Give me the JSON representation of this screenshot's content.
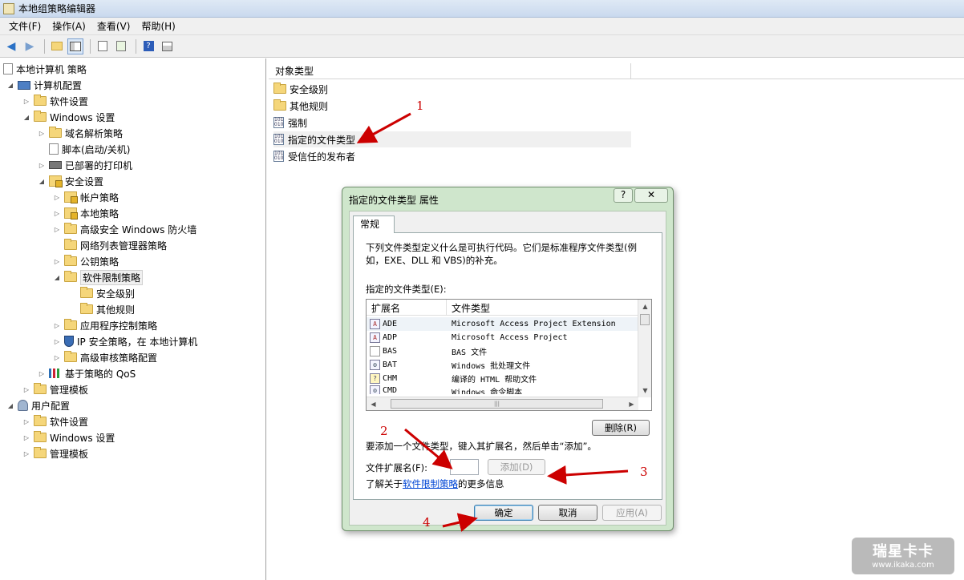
{
  "window": {
    "title": "本地组策略编辑器"
  },
  "menu": [
    "文件(F)",
    "操作(A)",
    "查看(V)",
    "帮助(H)"
  ],
  "tree": {
    "root": "本地计算机 策略",
    "computer_config": "计算机配置",
    "software_settings": "软件设置",
    "windows_settings": "Windows 设置",
    "dns_policy": "域名解析策略",
    "scripts": "脚本(启动/关机)",
    "printers": "已部署的打印机",
    "security_settings": "安全设置",
    "account_policy": "帐户策略",
    "local_policy": "本地策略",
    "firewall": "高级安全 Windows 防火墙",
    "netlist": "网络列表管理器策略",
    "pubkey": "公钥策略",
    "srp": "软件限制策略",
    "sec_levels": "安全级别",
    "other_rules": "其他规则",
    "applocker": "应用程序控制策略",
    "ipsec": "IP 安全策略，在 本地计算机",
    "audit": "高级审核策略配置",
    "qos": "基于策略的 QoS",
    "admin_templates": "管理模板",
    "user_config": "用户配置",
    "u_software": "软件设置",
    "u_windows": "Windows 设置",
    "u_admin": "管理模板"
  },
  "list": {
    "header": "对象类型",
    "items": [
      "安全级别",
      "其他规则",
      "强制",
      "指定的文件类型",
      "受信任的发布者"
    ]
  },
  "dialog": {
    "title": "指定的文件类型 属性",
    "help_glyph": "?",
    "tab": "常规",
    "description": "下列文件类型定义什么是可执行代码。它们是标准程序文件类型(例如，EXE、DLL 和 VBS)的补充。",
    "list_label": "指定的文件类型(E):",
    "col_ext": "扩展名",
    "col_type": "文件类型",
    "rows": [
      {
        "ext": "ADE",
        "type": "Microsoft Access Project Extension",
        "icon": "access-icon"
      },
      {
        "ext": "ADP",
        "type": "Microsoft Access Project",
        "icon": "access-icon"
      },
      {
        "ext": "BAS",
        "type": "BAS 文件",
        "icon": "blank-file-icon"
      },
      {
        "ext": "BAT",
        "type": "Windows 批处理文件",
        "icon": "gear-file-icon"
      },
      {
        "ext": "CHM",
        "type": "编译的 HTML 帮助文件",
        "icon": "help-file-icon"
      },
      {
        "ext": "CMD",
        "type": "Windows 命令脚本",
        "icon": "gear-file-icon"
      }
    ],
    "delete_btn": "删除(R)",
    "add_hint": "要添加一个文件类型，键入其扩展名，然后单击“添加”。",
    "ext_label": "文件扩展名(F):",
    "ext_value": "",
    "add_btn": "添加(D)",
    "info_prefix": "了解关于",
    "info_link": "软件限制策略",
    "info_suffix": "的更多信息",
    "ok_btn": "确定",
    "cancel_btn": "取消",
    "apply_btn": "应用(A)"
  },
  "annotations": [
    "1",
    "2",
    "3",
    "4"
  ],
  "watermark": {
    "line1": "瑞星卡卡",
    "line2": "www.ikaka.com"
  },
  "colors": {
    "annotation": "#c00000",
    "dialog_frame": "#cfe6cc",
    "link": "#0046d5"
  }
}
